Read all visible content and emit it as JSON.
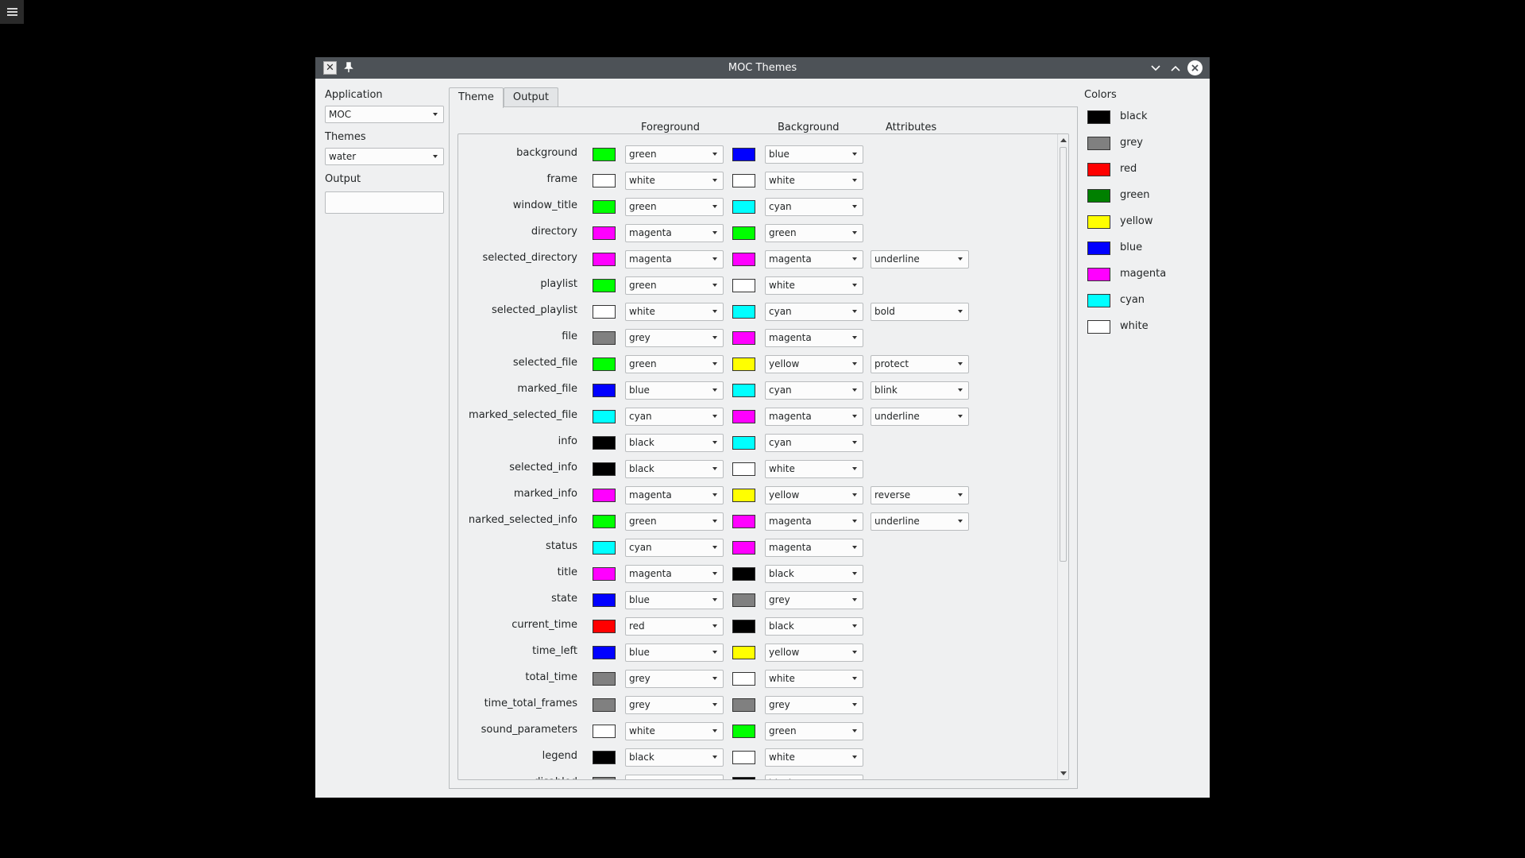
{
  "window": {
    "title": "MOC Themes"
  },
  "application": {
    "label": "Application",
    "value": "MOC"
  },
  "themes": {
    "label": "Themes",
    "value": "water"
  },
  "output": {
    "label": "Output",
    "value": ""
  },
  "tabs": [
    {
      "label": "Theme",
      "active": true
    },
    {
      "label": "Output",
      "active": false
    }
  ],
  "headers": {
    "foreground": "Foreground",
    "background": "Background",
    "attributes": "Attributes"
  },
  "colors_title": "Colors",
  "palette": {
    "black": "#000000",
    "grey": "#808080",
    "red": "#ff0000",
    "green": "#00ff00",
    "yellow": "#ffff00",
    "blue": "#0000ff",
    "magenta": "#ff00ff",
    "cyan": "#00ffff",
    "white": "#ffffff",
    "green_dark": "#008000"
  },
  "colors": [
    {
      "name": "black",
      "hex": "#000000"
    },
    {
      "name": "grey",
      "hex": "#808080"
    },
    {
      "name": "red",
      "hex": "#ff0000"
    },
    {
      "name": "green",
      "hex": "#008000"
    },
    {
      "name": "yellow",
      "hex": "#ffff00"
    },
    {
      "name": "blue",
      "hex": "#0000ff"
    },
    {
      "name": "magenta",
      "hex": "#ff00ff"
    },
    {
      "name": "cyan",
      "hex": "#00ffff"
    },
    {
      "name": "white",
      "hex": "#ffffff"
    }
  ],
  "rows": [
    {
      "name": "background",
      "fg": "green",
      "bg": "blue",
      "attr": ""
    },
    {
      "name": "frame",
      "fg": "white",
      "bg": "white",
      "attr": ""
    },
    {
      "name": "window_title",
      "fg": "green",
      "bg": "cyan",
      "attr": ""
    },
    {
      "name": "directory",
      "fg": "magenta",
      "bg": "green",
      "attr": ""
    },
    {
      "name": "selected_directory",
      "fg": "magenta",
      "bg": "magenta",
      "attr": "underline"
    },
    {
      "name": "playlist",
      "fg": "green",
      "bg": "white",
      "attr": ""
    },
    {
      "name": "selected_playlist",
      "fg": "white",
      "bg": "cyan",
      "attr": "bold"
    },
    {
      "name": "file",
      "fg": "grey",
      "bg": "magenta",
      "attr": ""
    },
    {
      "name": "selected_file",
      "fg": "green",
      "bg": "yellow",
      "attr": "protect"
    },
    {
      "name": "marked_file",
      "fg": "blue",
      "bg": "cyan",
      "attr": "blink"
    },
    {
      "name": "marked_selected_file",
      "fg": "cyan",
      "bg": "magenta",
      "attr": "underline"
    },
    {
      "name": "info",
      "fg": "black",
      "bg": "cyan",
      "attr": ""
    },
    {
      "name": "selected_info",
      "fg": "black",
      "bg": "white",
      "attr": ""
    },
    {
      "name": "marked_info",
      "fg": "magenta",
      "bg": "yellow",
      "attr": "reverse"
    },
    {
      "name": "narked_selected_info",
      "fg": "green",
      "bg": "magenta",
      "attr": "underline"
    },
    {
      "name": "status",
      "fg": "cyan",
      "bg": "magenta",
      "attr": ""
    },
    {
      "name": "title",
      "fg": "magenta",
      "bg": "black",
      "attr": ""
    },
    {
      "name": "state",
      "fg": "blue",
      "bg": "grey",
      "attr": ""
    },
    {
      "name": "current_time",
      "fg": "red",
      "bg": "black",
      "attr": ""
    },
    {
      "name": "time_left",
      "fg": "blue",
      "bg": "yellow",
      "attr": ""
    },
    {
      "name": "total_time",
      "fg": "grey",
      "bg": "white",
      "attr": ""
    },
    {
      "name": "time_total_frames",
      "fg": "grey",
      "bg": "grey",
      "attr": ""
    },
    {
      "name": "sound_parameters",
      "fg": "white",
      "bg": "green",
      "attr": ""
    },
    {
      "name": "legend",
      "fg": "black",
      "bg": "white",
      "attr": ""
    },
    {
      "name": "disabled",
      "fg": "grey",
      "bg": "black",
      "attr": ""
    }
  ]
}
